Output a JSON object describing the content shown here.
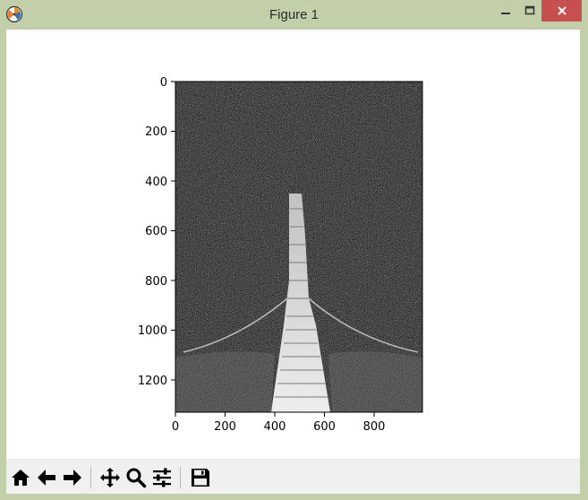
{
  "window": {
    "title": "Figure 1",
    "icon": "matplotlib-icon",
    "controls": [
      "minimize-icon",
      "maximize-icon",
      "close-icon"
    ]
  },
  "figure": {
    "image_description": "grayscale photo",
    "x_ticks": [
      "0",
      "200",
      "400",
      "600",
      "800"
    ],
    "y_ticks": [
      "0",
      "200",
      "400",
      "600",
      "800",
      "1000",
      "1200"
    ]
  },
  "toolbar": {
    "buttons": [
      {
        "name": "home-button",
        "icon": "home-icon"
      },
      {
        "name": "back-button",
        "icon": "arrow-left-icon"
      },
      {
        "name": "forward-button",
        "icon": "arrow-right-icon"
      },
      {
        "name": "pan-button",
        "icon": "move-icon"
      },
      {
        "name": "zoom-button",
        "icon": "magnifier-icon"
      },
      {
        "name": "configure-subplots-button",
        "icon": "sliders-icon"
      },
      {
        "name": "save-button",
        "icon": "floppy-disk-icon"
      }
    ]
  },
  "colors": {
    "title_bar": "#c3cfa8",
    "close_button": "#c7504e",
    "toolbar": "#f0f0f0"
  }
}
